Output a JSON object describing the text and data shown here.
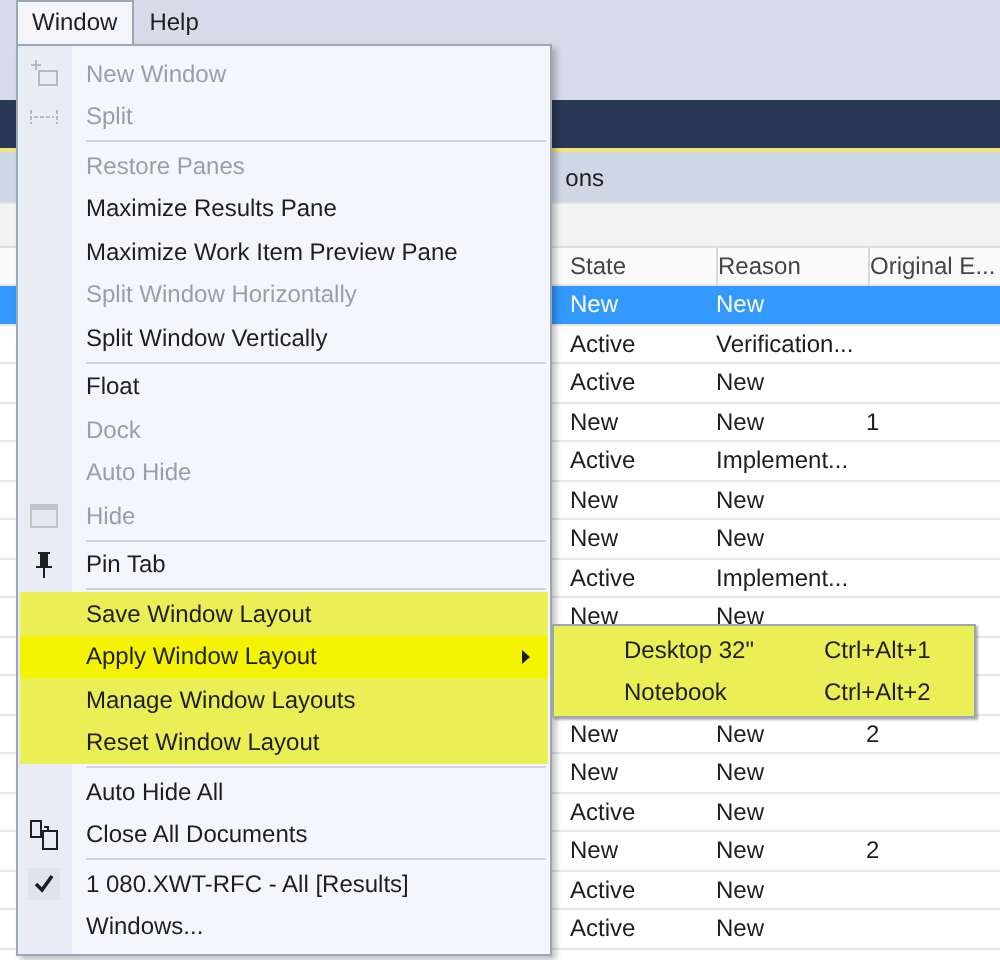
{
  "menubar": [
    {
      "label": "Window",
      "selected": true
    },
    {
      "label": "Help",
      "selected": false
    }
  ],
  "document_tab": {
    "label": "ons"
  },
  "table": {
    "columns": [
      "State",
      "Reason",
      "Original E..."
    ],
    "rows": [
      {
        "cells": [
          "New",
          "New",
          ""
        ],
        "selected": true
      },
      {
        "cells": [
          "Active",
          "Verification...",
          ""
        ],
        "selected": false
      },
      {
        "cells": [
          "Active",
          "New",
          ""
        ],
        "selected": false
      },
      {
        "cells": [
          "New",
          "New",
          "1"
        ],
        "selected": false
      },
      {
        "cells": [
          "Active",
          "Implement...",
          ""
        ],
        "selected": false
      },
      {
        "cells": [
          "New",
          "New",
          ""
        ],
        "selected": false
      },
      {
        "cells": [
          "New",
          "New",
          ""
        ],
        "selected": false
      },
      {
        "cells": [
          "Active",
          "Implement...",
          ""
        ],
        "selected": false
      },
      {
        "cells": [
          "New",
          "New",
          ""
        ],
        "selected": false
      },
      {
        "cells": [],
        "selected": false
      },
      {
        "cells": [],
        "selected": false
      },
      {
        "cells": [
          "New",
          "New",
          "2"
        ],
        "selected": false
      },
      {
        "cells": [
          "New",
          "New",
          ""
        ],
        "selected": false
      },
      {
        "cells": [
          "Active",
          "New",
          ""
        ],
        "selected": false
      },
      {
        "cells": [
          "New",
          "New",
          "2"
        ],
        "selected": false
      },
      {
        "cells": [
          "Active",
          "New",
          ""
        ],
        "selected": false
      },
      {
        "cells": [
          "Active",
          "New",
          ""
        ],
        "selected": false
      }
    ]
  },
  "menu": {
    "items": [
      {
        "kind": "item",
        "label": "New Window",
        "disabled": true,
        "highlighted": false,
        "selected": false,
        "checked": false
      },
      {
        "kind": "item",
        "label": "Split",
        "disabled": true,
        "highlighted": false,
        "selected": false,
        "checked": false
      },
      {
        "kind": "separator"
      },
      {
        "kind": "item",
        "label": "Restore Panes",
        "disabled": true,
        "highlighted": false,
        "selected": false,
        "checked": false
      },
      {
        "kind": "item",
        "label": "Maximize Results Pane",
        "disabled": false,
        "highlighted": false,
        "selected": false,
        "checked": false
      },
      {
        "kind": "item",
        "label": "Maximize Work Item Preview Pane",
        "disabled": false,
        "highlighted": false,
        "selected": false,
        "checked": false
      },
      {
        "kind": "item",
        "label": "Split Window Horizontally",
        "disabled": true,
        "highlighted": false,
        "selected": false,
        "checked": false
      },
      {
        "kind": "item",
        "label": "Split Window Vertically",
        "disabled": false,
        "highlighted": false,
        "selected": false,
        "checked": false
      },
      {
        "kind": "separator"
      },
      {
        "kind": "item",
        "label": "Float",
        "disabled": false,
        "highlighted": false,
        "selected": false,
        "checked": false
      },
      {
        "kind": "item",
        "label": "Dock",
        "disabled": true,
        "highlighted": false,
        "selected": false,
        "checked": false
      },
      {
        "kind": "item",
        "label": "Auto Hide",
        "disabled": true,
        "highlighted": false,
        "selected": false,
        "checked": false
      },
      {
        "kind": "item",
        "label": "Hide",
        "disabled": true,
        "highlighted": false,
        "selected": false,
        "checked": false
      },
      {
        "kind": "separator"
      },
      {
        "kind": "item",
        "label": "Pin Tab",
        "disabled": false,
        "highlighted": false,
        "selected": false,
        "checked": false
      },
      {
        "kind": "separator"
      },
      {
        "kind": "item",
        "label": "Save Window Layout",
        "disabled": false,
        "highlighted": true,
        "selected": false,
        "checked": false
      },
      {
        "kind": "item",
        "label": "Apply Window Layout",
        "disabled": false,
        "highlighted": true,
        "selected": true,
        "checked": false,
        "submenu": [
          {
            "label": "Desktop 32\"",
            "shortcut": "Ctrl+Alt+1"
          },
          {
            "label": "Notebook",
            "shortcut": "Ctrl+Alt+2"
          }
        ]
      },
      {
        "kind": "item",
        "label": "Manage Window Layouts",
        "disabled": false,
        "highlighted": true,
        "selected": false,
        "checked": false
      },
      {
        "kind": "item",
        "label": "Reset Window Layout",
        "disabled": false,
        "highlighted": true,
        "selected": false,
        "checked": false
      },
      {
        "kind": "separator"
      },
      {
        "kind": "item",
        "label": "Auto Hide All",
        "disabled": false,
        "highlighted": false,
        "selected": false,
        "checked": false
      },
      {
        "kind": "item",
        "label": "Close All Documents",
        "disabled": false,
        "highlighted": false,
        "selected": false,
        "checked": false
      },
      {
        "kind": "separator"
      },
      {
        "kind": "item",
        "label": "1 080.XWT-RFC - All [Results]",
        "disabled": false,
        "highlighted": false,
        "selected": false,
        "checked": true
      },
      {
        "kind": "item",
        "label": "Windows...",
        "disabled": false,
        "highlighted": false,
        "selected": false,
        "checked": false
      }
    ]
  }
}
